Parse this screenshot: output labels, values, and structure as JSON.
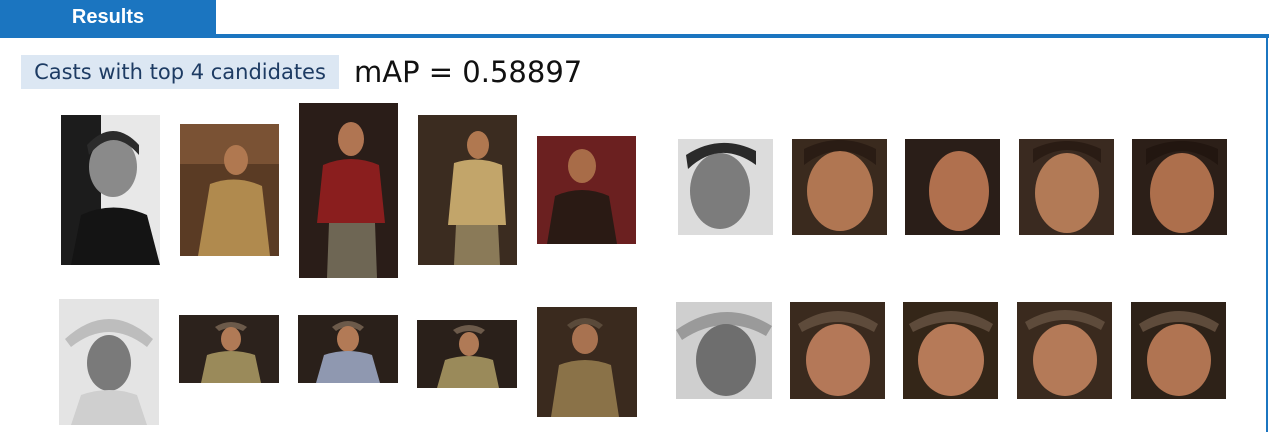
{
  "header": {
    "tab_label": "Results"
  },
  "summary": {
    "badge_label": "Casts with top 4 candidates",
    "metric_text": "mAP = 0.58897"
  },
  "colors": {
    "accent": "#1b75c0",
    "badge_bg": "#dce7f3"
  },
  "rows": [
    {
      "cast": "photo-1",
      "candidates": [
        "photo-2",
        "photo-3",
        "photo-4",
        "photo-5"
      ],
      "faces": [
        "face-1",
        "face-2",
        "face-3",
        "face-4",
        "face-5"
      ]
    },
    {
      "cast": "photo-1",
      "candidates": [
        "photo-2",
        "photo-3",
        "photo-4",
        "photo-5"
      ],
      "faces": [
        "face-1",
        "face-2",
        "face-3",
        "face-4",
        "face-5"
      ]
    }
  ]
}
